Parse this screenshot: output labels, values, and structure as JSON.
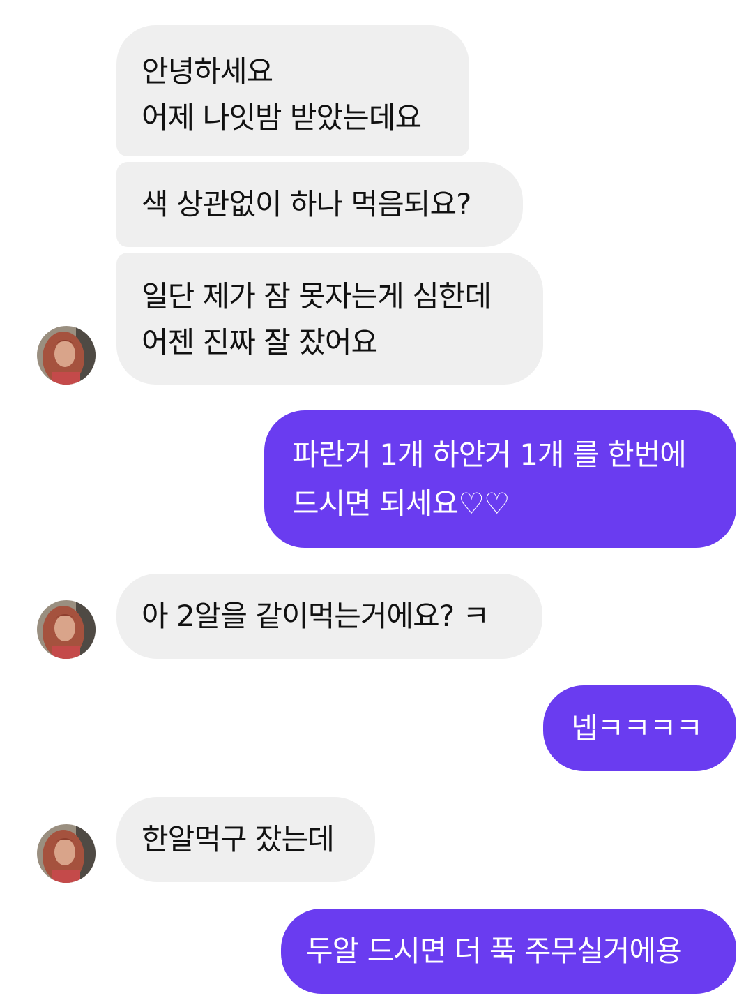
{
  "conversation": {
    "messages": [
      {
        "sender": "other",
        "lines": [
          "안녕하세요",
          "어제 나잇밤 받았는데요"
        ]
      },
      {
        "sender": "other",
        "lines": [
          "색 상관없이 하나 먹음되요?"
        ]
      },
      {
        "sender": "other",
        "lines": [
          "일단 제가 잠 못자는게 심한데",
          "어젠 진짜 잘 잤어요"
        ]
      },
      {
        "sender": "me",
        "lines": [
          "파란거 1개 하얀거 1개 를 한번에",
          "드시면 되세요♡♡"
        ]
      },
      {
        "sender": "other",
        "lines": [
          "아 2알을 같이먹는거에요? ㅋ"
        ]
      },
      {
        "sender": "me",
        "lines": [
          "넵ㅋㅋㅋㅋ"
        ]
      },
      {
        "sender": "other",
        "lines": [
          "한알먹구 잤는데"
        ]
      },
      {
        "sender": "me",
        "lines": [
          "두알 드시면 더 푹 주무실거에용"
        ]
      }
    ]
  },
  "colors": {
    "incoming_bubble": "#efefef",
    "outgoing_bubble": "#6a3cf0",
    "incoming_text": "#111111",
    "outgoing_text": "#ffffff"
  },
  "icons": {
    "avatar": "profile-photo-avatar"
  }
}
